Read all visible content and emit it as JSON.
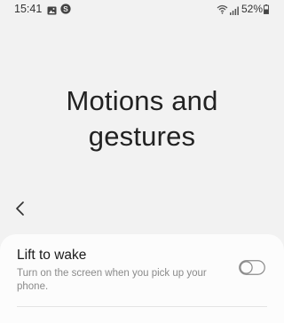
{
  "status_bar": {
    "time": "15:41",
    "battery": "52%",
    "icons": [
      "gallery-icon",
      "skype-icon",
      "wifi-icon",
      "signal-icon",
      "battery-icon"
    ]
  },
  "header": {
    "title_line1": "Motions and",
    "title_line2": "gestures",
    "back_icon": "chevron-left-icon"
  },
  "settings": [
    {
      "title": "Lift to wake",
      "description": "Turn on the screen when you pick up your phone.",
      "enabled": false
    }
  ],
  "colors": {
    "background": "#f2f2f2",
    "card": "#fcfcfc",
    "toggle_off": "#8a8a8a"
  }
}
